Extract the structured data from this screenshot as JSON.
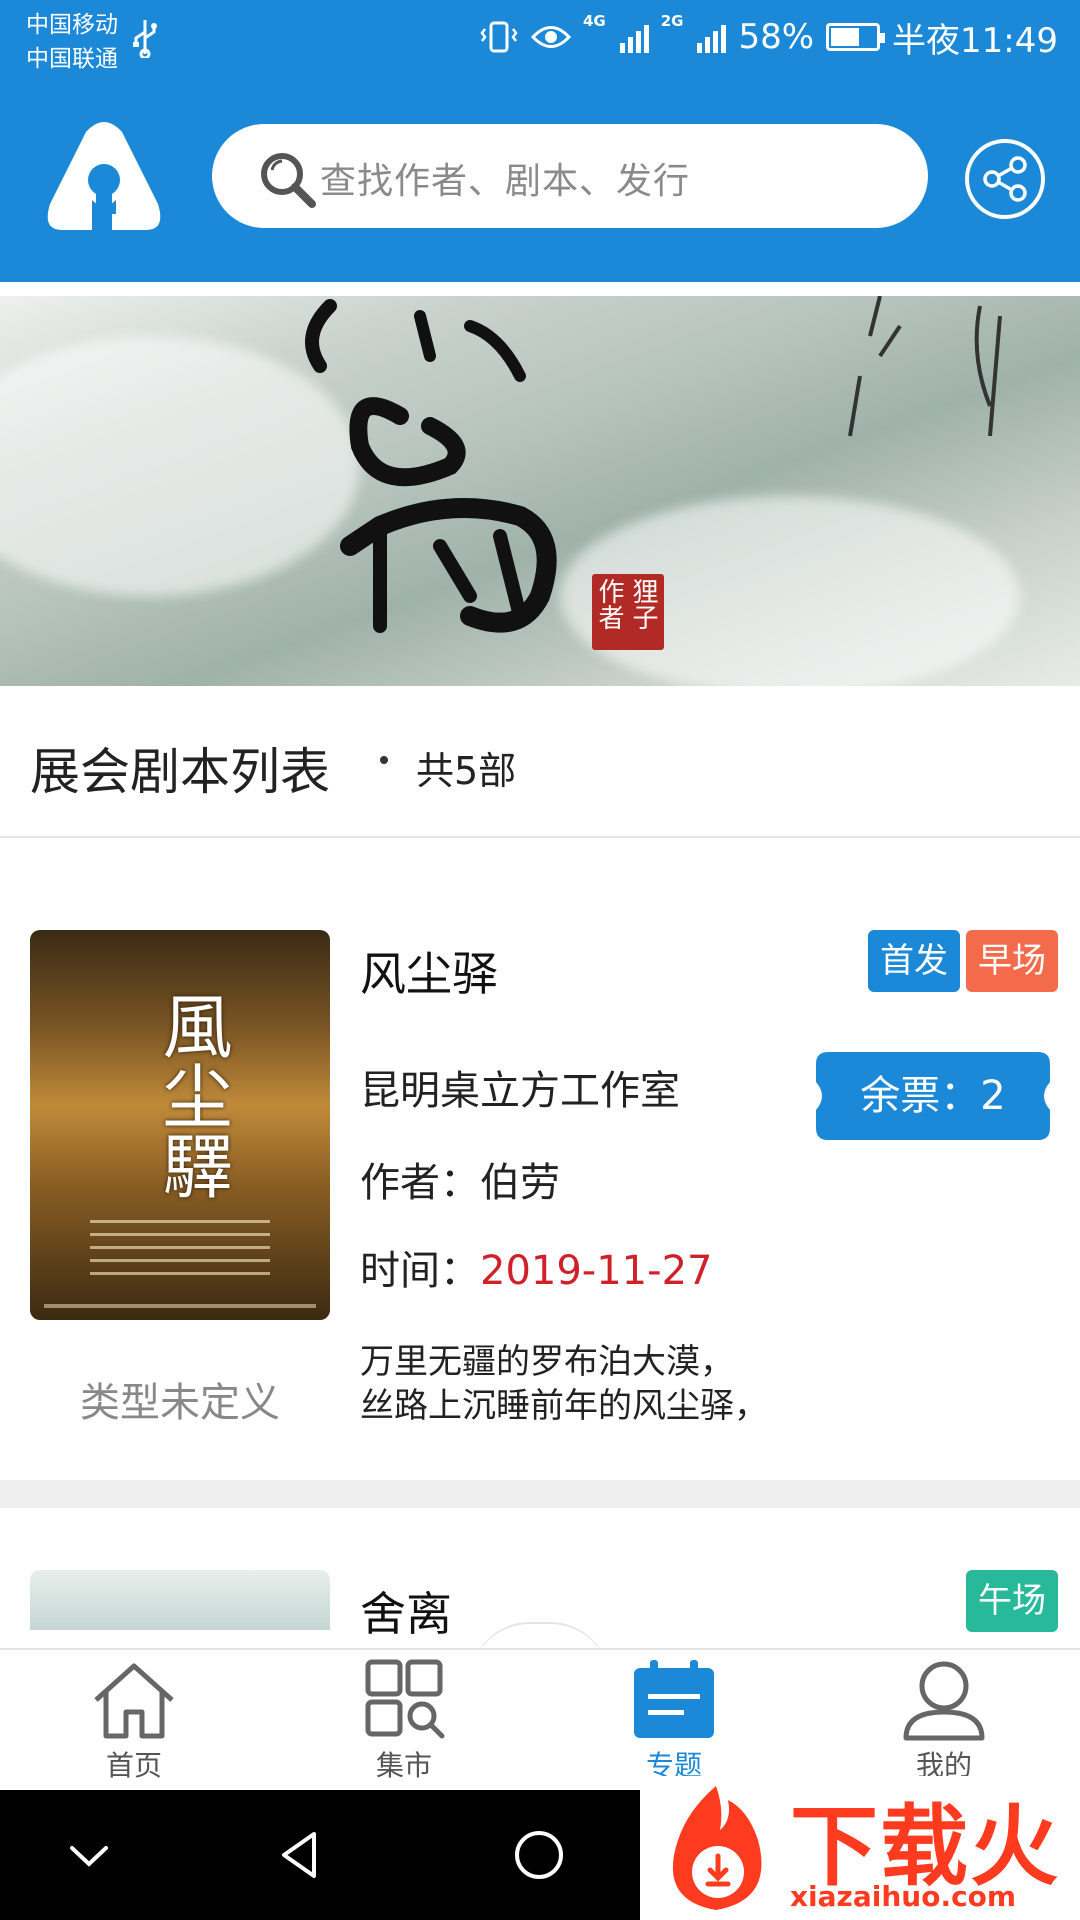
{
  "status_bar": {
    "carrier_1": "中国移动",
    "carrier_2": "中国联通",
    "network_1": "4G",
    "network_2": "2G",
    "battery": "58%",
    "time": "半夜11:49"
  },
  "header": {
    "search_placeholder": "查找作者、剧本、发行",
    "icons": [
      "app-logo-icon",
      "search-icon",
      "share-icon"
    ]
  },
  "banner": {
    "seal_text": "狸子作者"
  },
  "list": {
    "title": "展会剧本列表",
    "count": "共5部"
  },
  "scripts": [
    {
      "name": "风尘驿",
      "tags": [
        "首发",
        "早场"
      ],
      "studio": "昆明桌立方工作室",
      "author_label": "作者：",
      "author": "伯劳",
      "time_label": "时间：",
      "time": "2019-11-27",
      "tickets_label": "余票：",
      "tickets": "2",
      "genre": "类型未定义",
      "description": [
        "万里无疆的罗布泊大漠，",
        "丝路上沉睡前年的风尘驿，"
      ],
      "cover_title": "風尘驛"
    },
    {
      "name": "舍离",
      "tags": [
        "午场"
      ]
    }
  ],
  "bottom_nav": [
    {
      "label": "首页",
      "icon": "home-icon"
    },
    {
      "label": "集市",
      "icon": "market-icon"
    },
    {
      "label": "专题",
      "icon": "topic-icon",
      "active": true
    },
    {
      "label": "我的",
      "icon": "profile-icon"
    }
  ],
  "colors": {
    "primary": "#1b88d8",
    "red_tag": "#f36b4a",
    "green_tag": "#27b999",
    "date_red": "#d0202a"
  },
  "watermark": {
    "text": "下载火",
    "url": "xiazaihuo.com"
  }
}
